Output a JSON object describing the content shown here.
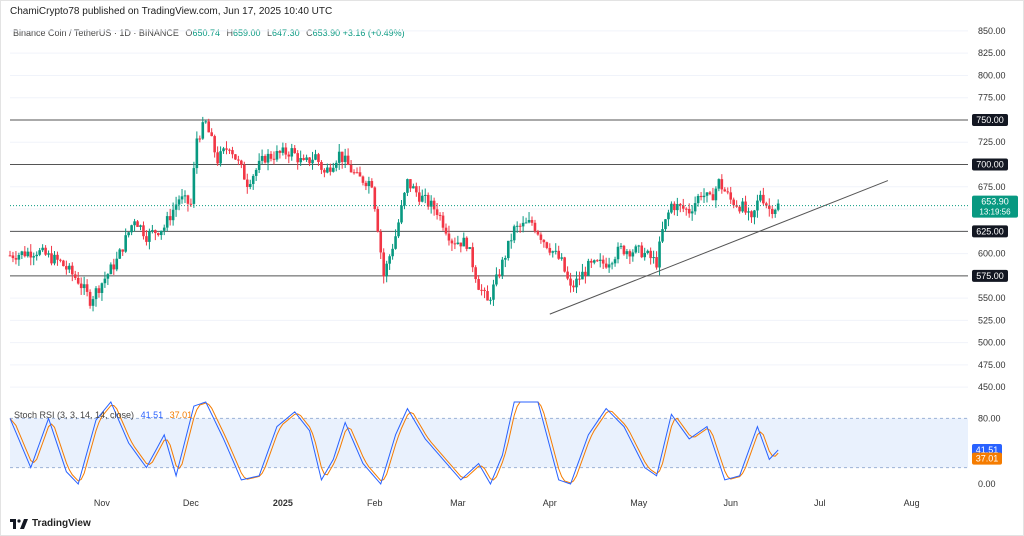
{
  "header": {
    "published": "ChamiCrypto78 published on TradingView.com, Jun 17, 2025 10:40 UTC"
  },
  "legend": {
    "symbol": "Binance Coin / TetherUS · 1D · BINANCE",
    "open_label": "O",
    "open": "650.74",
    "high_label": "H",
    "high": "659.00",
    "low_label": "L",
    "low": "647.30",
    "close_label": "C",
    "close": "653.90",
    "change": "+3.16 (+0.49%)"
  },
  "price_tag": {
    "price": "653.90",
    "countdown": "13:19:56"
  },
  "rsi": {
    "title": "Stoch RSI (3, 3, 14, 14, close)",
    "k": "41.51",
    "d": "37.01",
    "ticks": [
      "80.00",
      "0.00"
    ],
    "k_color": "#2962ff",
    "d_color": "#f57c00"
  },
  "logo": {
    "text": "TradingView"
  },
  "colors": {
    "up": "#089981",
    "down": "#f23645",
    "level_line": "#555555",
    "trend_line": "#555555"
  },
  "chart_data": {
    "type": "candlestick",
    "ylim": [
      430,
      860
    ],
    "y_ticks": [
      450,
      475,
      500,
      525,
      550,
      575,
      600,
      625,
      650,
      675,
      700,
      725,
      750,
      775,
      800,
      825,
      850
    ],
    "y_tick_labels": [
      "450.00",
      "475.00",
      "500.00",
      "525.00",
      "550.00",
      "575.00",
      "600.00",
      "625.00",
      "650.00",
      "675.00",
      "700.00",
      "725.00",
      "750.00",
      "775.00",
      "800.00",
      "825.00",
      "850.00"
    ],
    "highlighted_levels": [
      750,
      700,
      625,
      575
    ],
    "highlighted_labels": [
      "750.00",
      "700.00",
      "625.00",
      "575.00"
    ],
    "x_labels": [
      "Nov",
      "Dec",
      "2025",
      "Feb",
      "Mar",
      "Apr",
      "May",
      "Jun",
      "Jul",
      "Aug"
    ],
    "trendline": [
      {
        "date": "2025-04-01",
        "price": 532
      },
      {
        "date": "2025-07-24",
        "price": 682
      }
    ],
    "series_anchors": [
      {
        "date": "2024-10-01",
        "price": 598
      },
      {
        "date": "2024-10-10",
        "price": 603
      },
      {
        "date": "2024-10-18",
        "price": 590
      },
      {
        "date": "2024-10-24",
        "price": 570
      },
      {
        "date": "2024-10-28",
        "price": 548
      },
      {
        "date": "2024-11-06",
        "price": 592
      },
      {
        "date": "2024-11-12",
        "price": 640
      },
      {
        "date": "2024-11-16",
        "price": 620
      },
      {
        "date": "2024-11-22",
        "price": 630
      },
      {
        "date": "2024-11-27",
        "price": 662
      },
      {
        "date": "2024-12-01",
        "price": 655
      },
      {
        "date": "2024-12-03",
        "price": 730
      },
      {
        "date": "2024-12-06",
        "price": 746
      },
      {
        "date": "2024-12-10",
        "price": 705
      },
      {
        "date": "2024-12-14",
        "price": 722
      },
      {
        "date": "2024-12-20",
        "price": 680
      },
      {
        "date": "2024-12-26",
        "price": 708
      },
      {
        "date": "2025-01-04",
        "price": 715
      },
      {
        "date": "2025-01-08",
        "price": 700
      },
      {
        "date": "2025-01-12",
        "price": 710
      },
      {
        "date": "2025-01-15",
        "price": 690
      },
      {
        "date": "2025-01-20",
        "price": 712
      },
      {
        "date": "2025-01-26",
        "price": 685
      },
      {
        "date": "2025-01-31",
        "price": 680
      },
      {
        "date": "2025-02-02",
        "price": 630
      },
      {
        "date": "2025-02-04",
        "price": 575
      },
      {
        "date": "2025-02-08",
        "price": 620
      },
      {
        "date": "2025-02-12",
        "price": 680
      },
      {
        "date": "2025-02-16",
        "price": 665
      },
      {
        "date": "2025-02-22",
        "price": 648
      },
      {
        "date": "2025-02-27",
        "price": 615
      },
      {
        "date": "2025-03-04",
        "price": 612
      },
      {
        "date": "2025-03-08",
        "price": 565
      },
      {
        "date": "2025-03-11",
        "price": 545
      },
      {
        "date": "2025-03-14",
        "price": 570
      },
      {
        "date": "2025-03-20",
        "price": 627
      },
      {
        "date": "2025-03-26",
        "price": 635
      },
      {
        "date": "2025-03-30",
        "price": 615
      },
      {
        "date": "2025-04-05",
        "price": 590
      },
      {
        "date": "2025-04-08",
        "price": 560
      },
      {
        "date": "2025-04-14",
        "price": 585
      },
      {
        "date": "2025-04-20",
        "price": 590
      },
      {
        "date": "2025-04-25",
        "price": 605
      },
      {
        "date": "2025-05-02",
        "price": 602
      },
      {
        "date": "2025-05-07",
        "price": 590
      },
      {
        "date": "2025-05-09",
        "price": 625
      },
      {
        "date": "2025-05-12",
        "price": 655
      },
      {
        "date": "2025-05-18",
        "price": 648
      },
      {
        "date": "2025-05-22",
        "price": 668
      },
      {
        "date": "2025-05-25",
        "price": 660
      },
      {
        "date": "2025-05-28",
        "price": 680
      },
      {
        "date": "2025-06-01",
        "price": 660
      },
      {
        "date": "2025-06-05",
        "price": 652
      },
      {
        "date": "2025-06-08",
        "price": 635
      },
      {
        "date": "2025-06-11",
        "price": 668
      },
      {
        "date": "2025-06-14",
        "price": 650
      },
      {
        "date": "2025-06-17",
        "price": 654
      }
    ],
    "stoch_k_anchors": [
      {
        "date": "2024-10-01",
        "v": 80
      },
      {
        "date": "2024-10-08",
        "v": 20
      },
      {
        "date": "2024-10-14",
        "v": 80
      },
      {
        "date": "2024-10-20",
        "v": 15
      },
      {
        "date": "2024-10-24",
        "v": 0
      },
      {
        "date": "2024-10-30",
        "v": 78
      },
      {
        "date": "2024-11-04",
        "v": 100
      },
      {
        "date": "2024-11-10",
        "v": 50
      },
      {
        "date": "2024-11-16",
        "v": 20
      },
      {
        "date": "2024-11-22",
        "v": 60
      },
      {
        "date": "2024-11-26",
        "v": 10
      },
      {
        "date": "2024-12-02",
        "v": 95
      },
      {
        "date": "2024-12-06",
        "v": 100
      },
      {
        "date": "2024-12-12",
        "v": 55
      },
      {
        "date": "2024-12-18",
        "v": 5
      },
      {
        "date": "2024-12-24",
        "v": 10
      },
      {
        "date": "2024-12-30",
        "v": 70
      },
      {
        "date": "2025-01-05",
        "v": 88
      },
      {
        "date": "2025-01-10",
        "v": 65
      },
      {
        "date": "2025-01-14",
        "v": 5
      },
      {
        "date": "2025-01-18",
        "v": 30
      },
      {
        "date": "2025-01-22",
        "v": 75
      },
      {
        "date": "2025-01-28",
        "v": 25
      },
      {
        "date": "2025-02-03",
        "v": 0
      },
      {
        "date": "2025-02-08",
        "v": 60
      },
      {
        "date": "2025-02-12",
        "v": 92
      },
      {
        "date": "2025-02-18",
        "v": 55
      },
      {
        "date": "2025-02-24",
        "v": 30
      },
      {
        "date": "2025-03-02",
        "v": 5
      },
      {
        "date": "2025-03-08",
        "v": 25
      },
      {
        "date": "2025-03-12",
        "v": 0
      },
      {
        "date": "2025-03-16",
        "v": 35
      },
      {
        "date": "2025-03-20",
        "v": 100
      },
      {
        "date": "2025-03-28",
        "v": 100
      },
      {
        "date": "2025-04-04",
        "v": 5
      },
      {
        "date": "2025-04-08",
        "v": 0
      },
      {
        "date": "2025-04-14",
        "v": 60
      },
      {
        "date": "2025-04-20",
        "v": 92
      },
      {
        "date": "2025-04-26",
        "v": 70
      },
      {
        "date": "2025-05-03",
        "v": 20
      },
      {
        "date": "2025-05-07",
        "v": 10
      },
      {
        "date": "2025-05-12",
        "v": 85
      },
      {
        "date": "2025-05-18",
        "v": 55
      },
      {
        "date": "2025-05-24",
        "v": 70
      },
      {
        "date": "2025-05-30",
        "v": 5
      },
      {
        "date": "2025-06-04",
        "v": 10
      },
      {
        "date": "2025-06-10",
        "v": 70
      },
      {
        "date": "2025-06-14",
        "v": 30
      },
      {
        "date": "2025-06-17",
        "v": 41.51
      }
    ]
  }
}
